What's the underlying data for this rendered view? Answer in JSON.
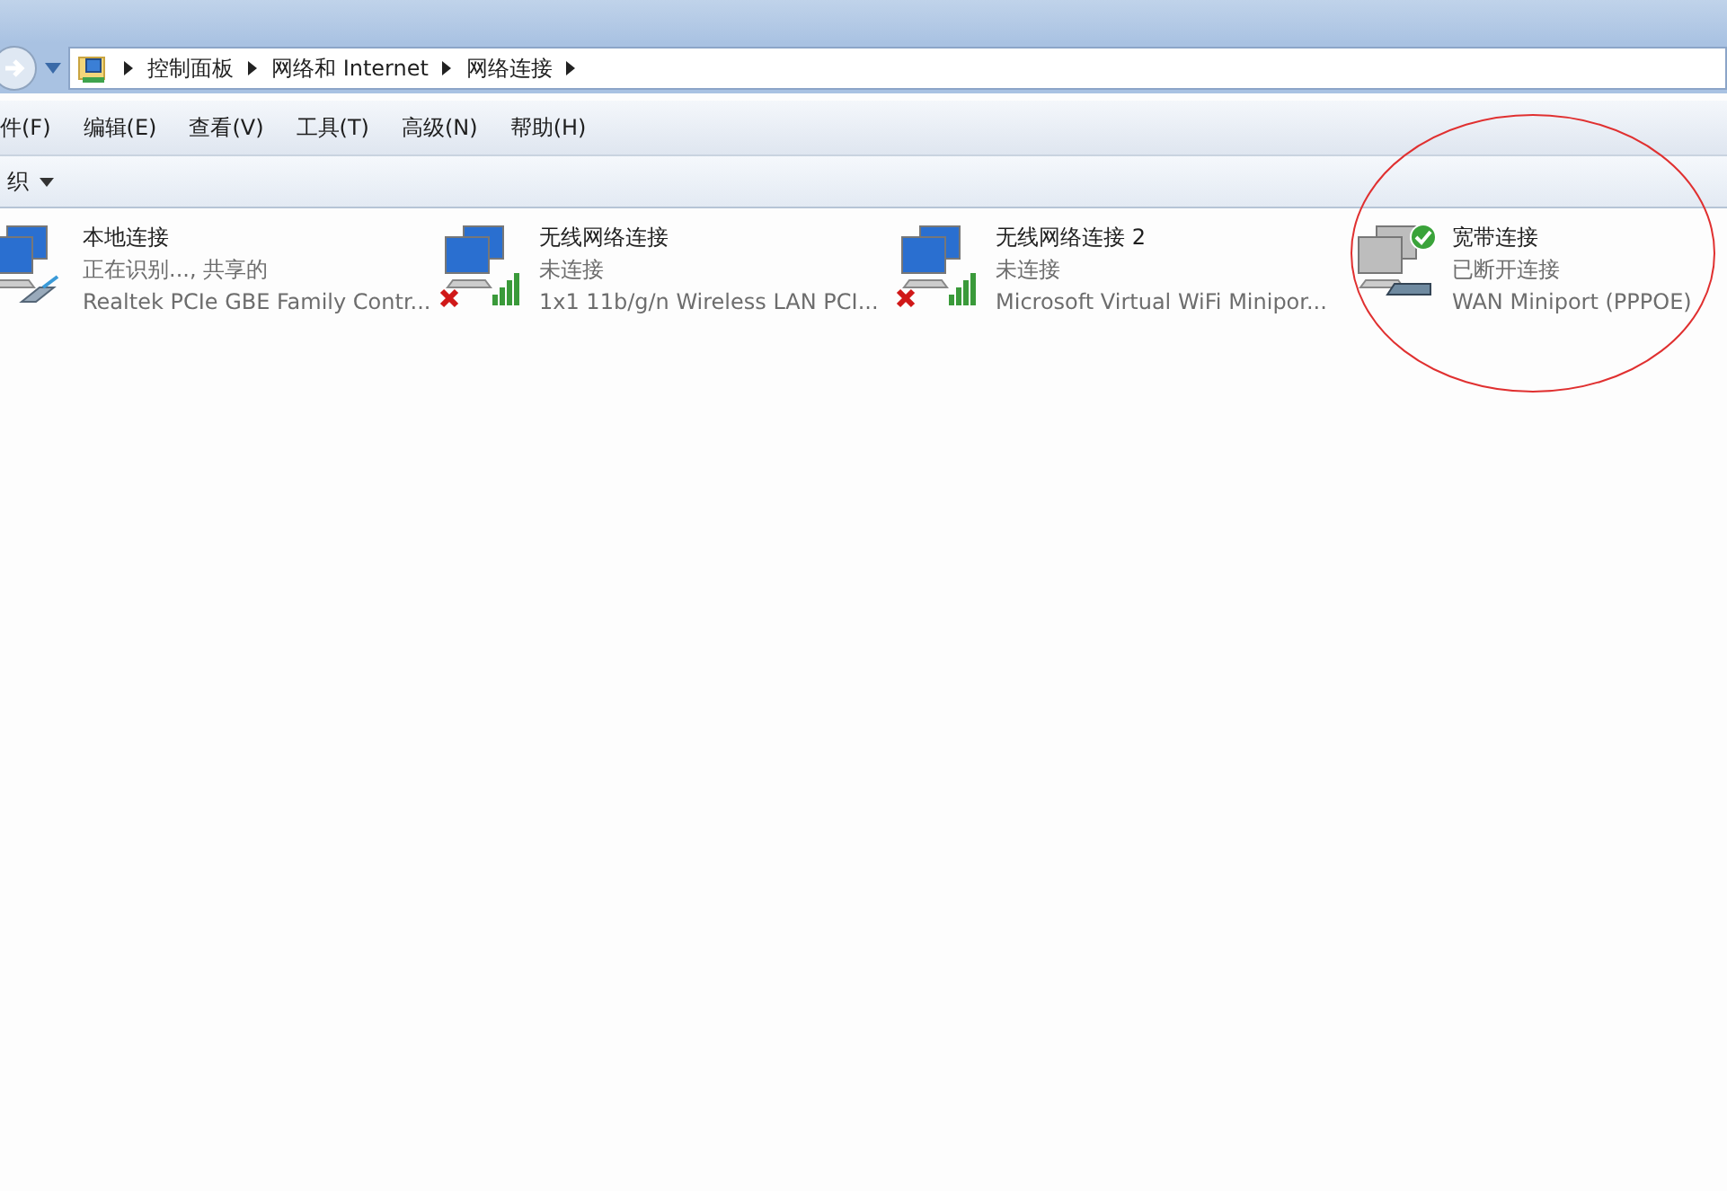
{
  "address_bar": {
    "crumbs": [
      "控制面板",
      "网络和 Internet",
      "网络连接"
    ]
  },
  "menu_bar": [
    "件(F)",
    "编辑(E)",
    "查看(V)",
    "工具(T)",
    "高级(N)",
    "帮助(H)"
  ],
  "toolbar": {
    "organize": "织"
  },
  "connections": [
    {
      "kind": "ethernet",
      "name": "本地连接",
      "status": "正在识别..., 共享的",
      "device": "Realtek PCIe GBE Family Contr...",
      "disconnected": false,
      "default": false
    },
    {
      "kind": "wireless",
      "name": "无线网络连接",
      "status": "未连接",
      "device": "1x1 11b/g/n Wireless LAN PCI...",
      "disconnected": true,
      "default": false
    },
    {
      "kind": "wireless",
      "name": "无线网络连接 2",
      "status": "未连接",
      "device": "Microsoft Virtual WiFi Minipor...",
      "disconnected": true,
      "default": false
    },
    {
      "kind": "broadband",
      "name": "宽带连接",
      "status": "已断开连接",
      "device": "WAN Miniport (PPPOE)",
      "disconnected": false,
      "default": true
    }
  ]
}
